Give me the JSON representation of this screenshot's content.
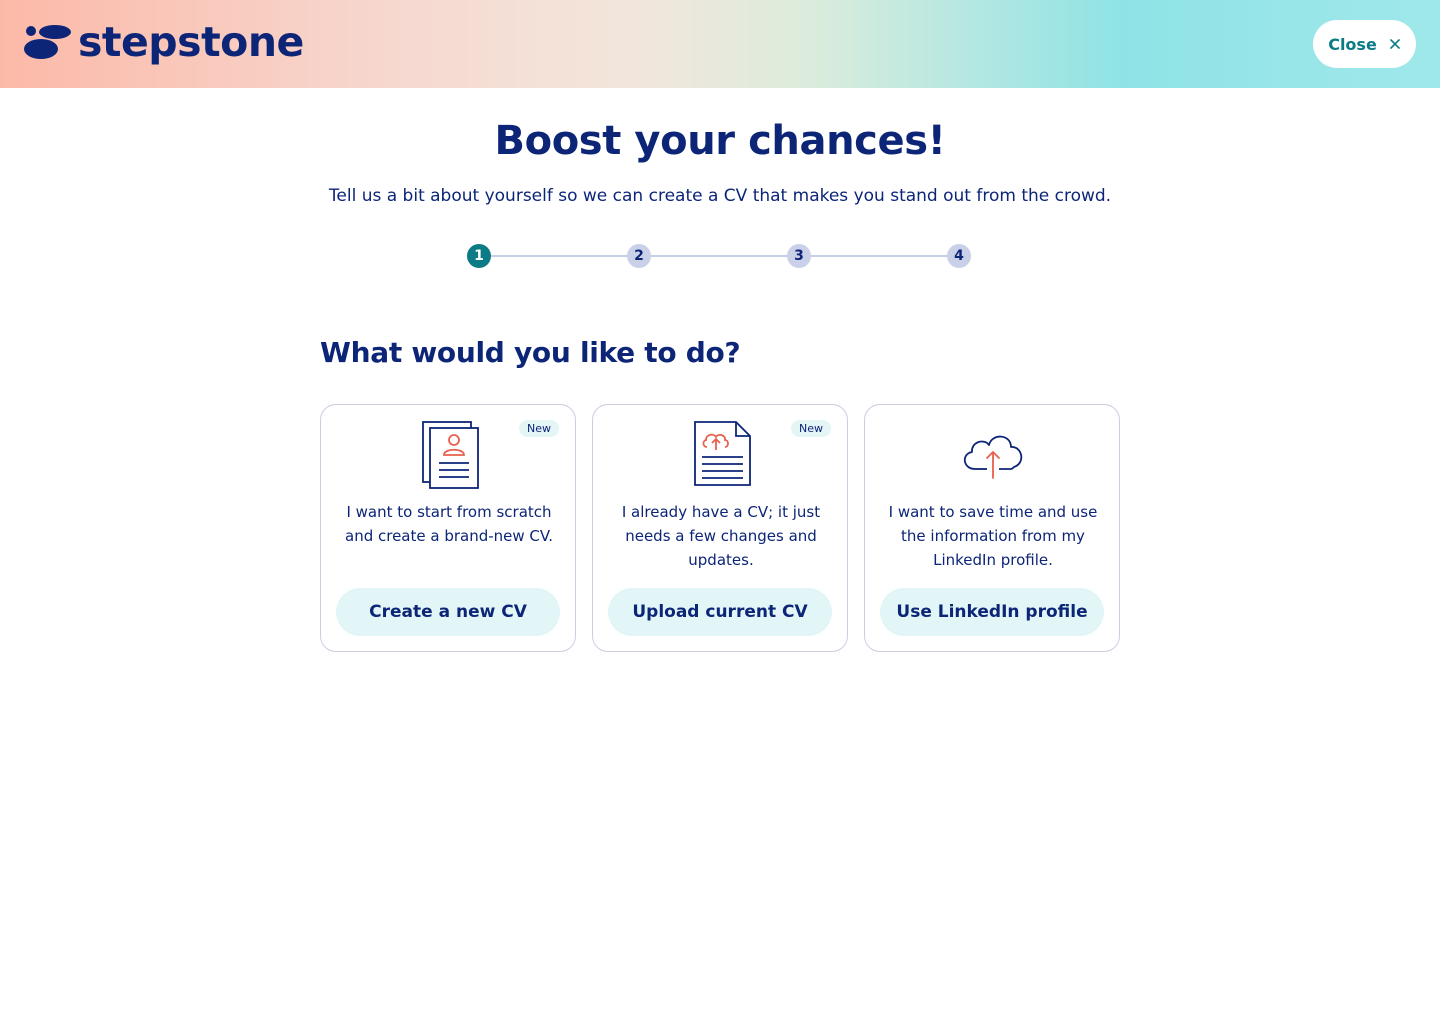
{
  "header": {
    "logo_text": "stepstone",
    "close_label": "Close",
    "close_icon": "close-icon"
  },
  "colors": {
    "navy": "#0c2577",
    "teal": "#0b7b86",
    "coral": "#e8604c",
    "cta_bg": "#e2f6f7"
  },
  "main": {
    "title": "Boost your chances!",
    "subtitle": "Tell us a bit about yourself so we can create a CV that makes you stand out from the crowd.",
    "steps": [
      "1",
      "2",
      "3",
      "4"
    ],
    "active_step": "1",
    "section_title": "What would you like to do?"
  },
  "cards": [
    {
      "badge": "New",
      "icon": "new-cv-document-icon",
      "description": "I want to start from scratch and create a brand-new CV.",
      "button": "Create a new CV"
    },
    {
      "badge": "New",
      "icon": "upload-document-icon",
      "description": "I already have a CV; it just needs a few changes and updates.",
      "button": "Upload current CV"
    },
    {
      "icon": "cloud-upload-icon",
      "description": "I want to save time and use the information from my LinkedIn profile.",
      "button": "Use LinkedIn profile"
    }
  ]
}
